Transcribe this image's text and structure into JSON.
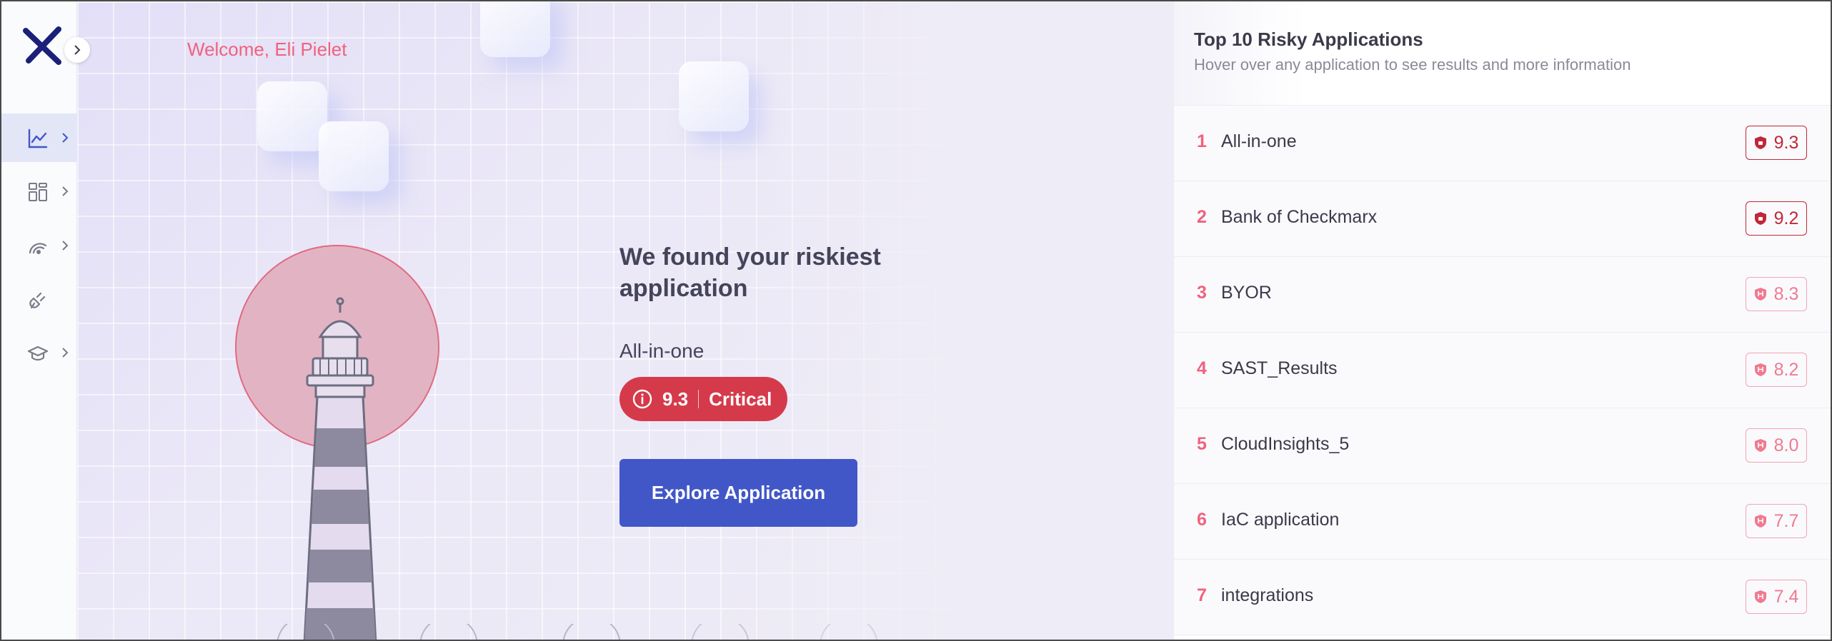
{
  "app": {
    "welcome_text": "Welcome, Eli Pielet"
  },
  "sidebar": {
    "items": [
      {
        "icon": "chart-line-icon",
        "active": true
      },
      {
        "icon": "dashboard-grid-icon",
        "active": false
      },
      {
        "icon": "radar-icon",
        "active": false
      },
      {
        "icon": "plug-icon",
        "active": false
      },
      {
        "icon": "graduation-cap-icon",
        "active": false
      }
    ]
  },
  "hero": {
    "title": "We found your riskiest application",
    "app_name": "All-in-one",
    "risk_score": "9.3",
    "risk_level": "Critical",
    "button_label": "Explore Application"
  },
  "panel": {
    "title": "Top 10 Risky Applications",
    "subtitle": "Hover over any application to see results and more information",
    "apps": [
      {
        "rank": "1",
        "name": "All-in-one",
        "score": "9.3",
        "severity": "critical"
      },
      {
        "rank": "2",
        "name": "Bank of Checkmarx",
        "score": "9.2",
        "severity": "critical"
      },
      {
        "rank": "3",
        "name": "BYOR",
        "score": "8.3",
        "severity": "high"
      },
      {
        "rank": "4",
        "name": "SAST_Results",
        "score": "8.2",
        "severity": "high"
      },
      {
        "rank": "5",
        "name": "CloudInsights_5",
        "score": "8.0",
        "severity": "high"
      },
      {
        "rank": "6",
        "name": "IaC application",
        "score": "7.7",
        "severity": "high"
      },
      {
        "rank": "7",
        "name": "integrations",
        "score": "7.4",
        "severity": "high"
      }
    ]
  },
  "colors": {
    "accent": "#4157c8",
    "critical": "#d53a4b",
    "rank": "#f0627d",
    "logo": "#1a1f7a"
  }
}
